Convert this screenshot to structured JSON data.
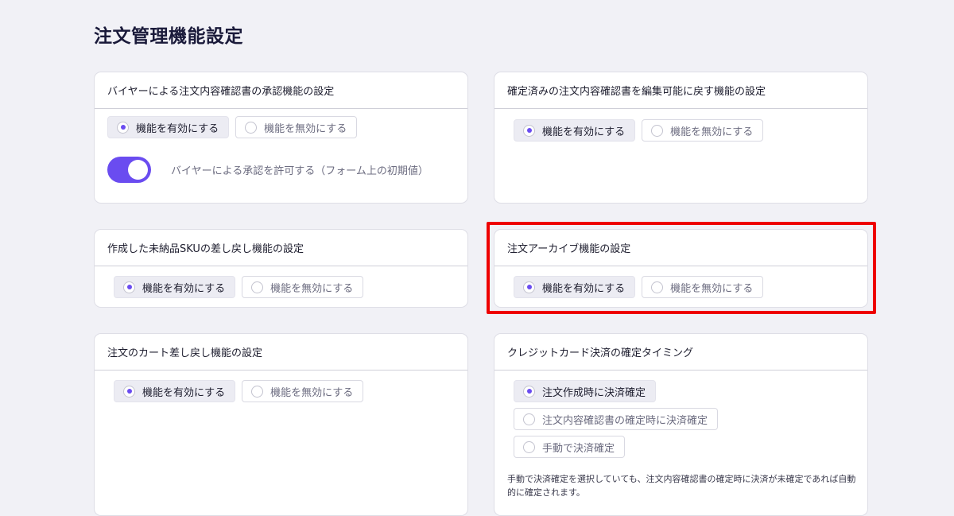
{
  "page_title": "注文管理機能設定",
  "option_enable": "機能を有効にする",
  "option_disable": "機能を無効にする",
  "cards": {
    "buyer_approval": {
      "title": "バイヤーによる注文内容確認書の承認機能の設定",
      "selected": "enable",
      "toggle_label": "バイヤーによる承認を許可する（フォーム上の初期値）",
      "toggle_on": true
    },
    "confirmed_revert": {
      "title": "確定済みの注文内容確認書を編集可能に戻す機能の設定",
      "selected": "enable"
    },
    "sku_revert": {
      "title": "作成した未納品SKUの差し戻し機能の設定",
      "selected": "enable"
    },
    "archive": {
      "title": "注文アーカイブ機能の設定",
      "selected": "enable"
    },
    "cart_revert": {
      "title": "注文のカート差し戻し機能の設定",
      "selected": "enable"
    },
    "credit_card": {
      "title": "クレジットカード決済の確定タイミング",
      "options": [
        "注文作成時に決済確定",
        "注文内容確認書の確定時に決済確定",
        "手動で決済確定"
      ],
      "selected_index": 0,
      "note": "手動で決済確定を選択していても、注文内容確認書の確定時に決済が未確定であれば自動的に確定されます。"
    }
  },
  "colors": {
    "accent": "#6a4cf0",
    "highlight": "#ee0000",
    "background": "#f1f1f6"
  }
}
